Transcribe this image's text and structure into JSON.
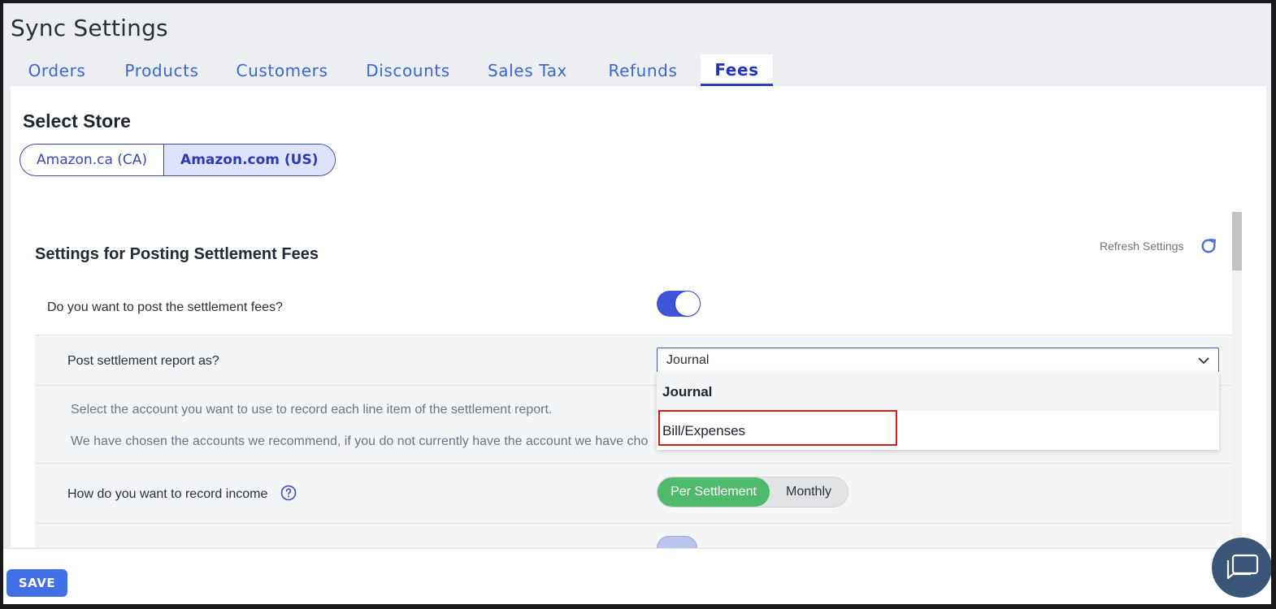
{
  "page": {
    "title": "Sync Settings"
  },
  "tabs": [
    {
      "label": "Orders",
      "active": false
    },
    {
      "label": "Products",
      "active": false
    },
    {
      "label": "Customers",
      "active": false
    },
    {
      "label": "Discounts",
      "active": false
    },
    {
      "label": "Sales Tax",
      "active": false
    },
    {
      "label": "Refunds",
      "active": false
    },
    {
      "label": "Fees",
      "active": true
    }
  ],
  "store": {
    "heading": "Select Store",
    "options": [
      {
        "label": "Amazon.ca (CA)",
        "active": false
      },
      {
        "label": "Amazon.com (US)",
        "active": true
      }
    ]
  },
  "settings": {
    "heading": "Settings for Posting Settlement Fees",
    "refresh_label": "Refresh Settings",
    "post_fees_question": "Do you want to post the settlement fees?",
    "post_fees_enabled": true,
    "post_report_question": "Post settlement report as?",
    "post_report_value": "Journal",
    "info_line1": "Select the account you want to use to record each line item of the settlement report.",
    "info_line2": "We have chosen the accounts we recommend, if you do not currently have the account we have cho",
    "income_question": "How do you want to record income",
    "income_options": [
      "Per Settlement",
      "Monthly"
    ],
    "income_selected": "Per Settlement"
  },
  "dropdown": {
    "options": [
      "Journal",
      "Bill/Expenses"
    ],
    "selected": "Journal",
    "highlighted": "Bill/Expenses"
  },
  "footer": {
    "save_label": "SAVE"
  },
  "colors": {
    "accent": "#3e55d9",
    "tab_active": "#2236b8",
    "toggle_green": "#4fb96c",
    "highlight_box": "#d81c1c",
    "save_button": "#4170e6",
    "chat_fab": "#3b5578"
  },
  "icons": {
    "refresh": "refresh-icon",
    "help": "question-circle-icon",
    "chevron": "chevron-down-icon",
    "chat": "chat-icon"
  }
}
